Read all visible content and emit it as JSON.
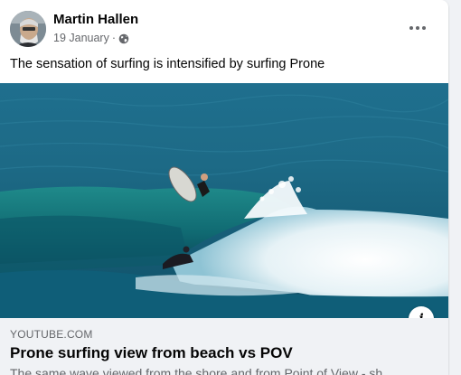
{
  "post": {
    "author": "Martin Hallen",
    "date": "19 January",
    "separator": "·",
    "privacy_icon": "globe-icon",
    "text": "The sensation of surfing is intensified by surfing Prone"
  },
  "menu": {
    "icon": "more-horizontal-icon"
  },
  "media": {
    "info_label": "i"
  },
  "link": {
    "domain": "YOUTUBE.COM",
    "title": "Prone surfing view from beach vs POV",
    "description": "The same wave viewed from the shore and from Point of View - sh"
  },
  "colors": {
    "card": "#ffffff",
    "secondary_text": "#65676b",
    "primary_text": "#050505",
    "link_bg": "#f0f2f5"
  }
}
